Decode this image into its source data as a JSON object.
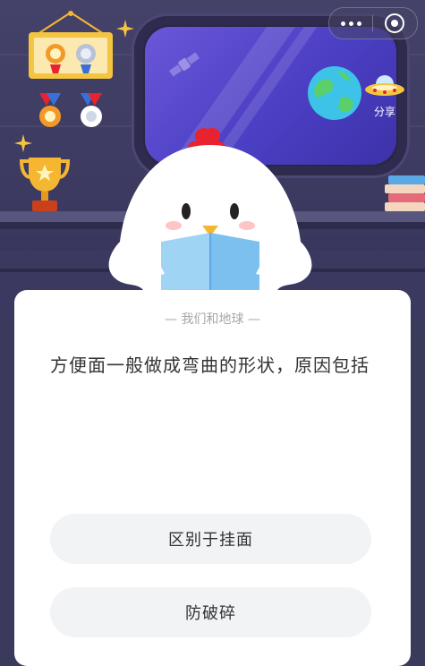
{
  "topbar": {
    "more_icon": "ellipsis-icon",
    "close_icon": "target-close-icon"
  },
  "share": {
    "label": "分享",
    "icon": "ufo-icon"
  },
  "card": {
    "category": "— 我们和地球 —",
    "question": "方便面一般做成弯曲的形状，原因包括",
    "options": [
      "区别于挂面",
      "防破碎"
    ]
  },
  "colors": {
    "scene_bg": "#3c3a60",
    "window_glass": "#5a4bd0",
    "option_bg": "#f2f3f5",
    "text_main": "#333333",
    "text_muted": "#a5a5ad",
    "gold": "#f5b731",
    "chicken_comb": "#e8222e"
  }
}
